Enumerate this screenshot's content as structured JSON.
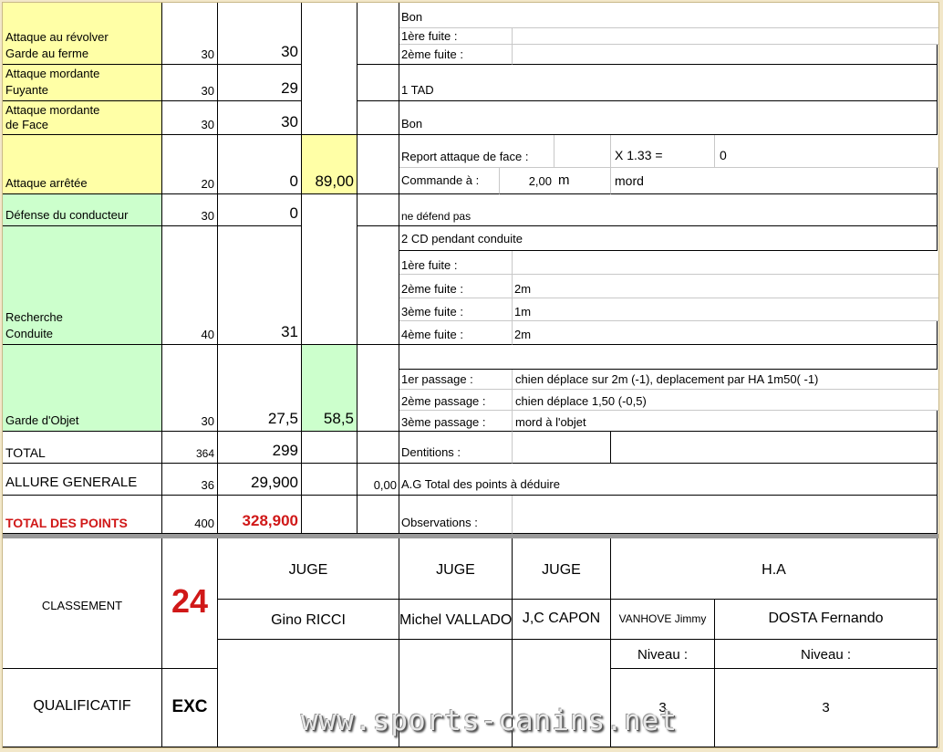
{
  "rows": {
    "revolver": {
      "label_1": "Attaque au révolver",
      "label_2": "Garde au ferme",
      "max": "30",
      "score": "30"
    },
    "fuyante": {
      "label_1": "Attaque mordante",
      "label_2": "Fuyante",
      "max": "30",
      "score": "29",
      "note": "1 TAD"
    },
    "face": {
      "label_1": "Attaque mordante",
      "label_2": "de Face",
      "max": "30",
      "score": "30",
      "note": "Bon"
    },
    "arretee": {
      "label": "Attaque arrêtée",
      "max": "20",
      "score": "0",
      "subtotal": "89,00",
      "report_label": "Report attaque de face :",
      "multiplier": "X 1.33 =",
      "report_value": "0",
      "command_label": "Commande à :",
      "command_value": "2,00",
      "command_unit": "m",
      "command_note": "mord"
    },
    "defense": {
      "label": "Défense du conducteur",
      "max": "30",
      "score": "0",
      "note": "ne défend pas"
    },
    "recherche": {
      "label_1": "Recherche",
      "label_2": "Conduite",
      "max": "40",
      "score": "31",
      "note": "2 CD pendant conduite",
      "fuite_1": "1ère fuite :",
      "fuite_2": "2ème fuite :",
      "fuite_2_val": "2m",
      "fuite_3": "3ème fuite :",
      "fuite_3_val": "1m",
      "fuite_4": "4ème fuite :",
      "fuite_4_val": "2m"
    },
    "garde": {
      "label": "Garde d'Objet",
      "max": "30",
      "score": "27,5",
      "subtotal": "58,5",
      "p1": "1er passage :",
      "p1_val": "chien déplace sur 2m (-1), deplacement par HA 1m50( -1)",
      "p2": "2ème passage :",
      "p2_val": "chien déplace 1,50 (-0,5)",
      "p3": "3ème passage :",
      "p3_val": "mord à l'objet"
    },
    "total": {
      "label": "TOTAL",
      "max": "364",
      "score": "299",
      "dent_label": "Dentitions :"
    },
    "allure": {
      "label": "ALLURE GENERALE",
      "max": "36",
      "score": "29,900",
      "deduct": "0,00",
      "deduct_label": "A.G  Total des points à déduire"
    },
    "points": {
      "label": "TOTAL DES POINTS",
      "max": "400",
      "score": "328,900",
      "obs_label": "Observations :"
    }
  },
  "top_notes": {
    "bon": "Bon",
    "fuite_1": "1ère fuite :",
    "fuite_2": "2ème fuite :"
  },
  "bottom": {
    "classement_label": "CLASSEMENT",
    "classement_value": "24",
    "qualif_label": "QUALIFICATIF",
    "qualif_value": "EXC",
    "judge_1_title": "JUGE",
    "judge_1_name": "Gino RICCI",
    "judge_2_title": "JUGE",
    "judge_2_name": "Michel VALLADON",
    "judge_3_title": "JUGE",
    "judge_3_name": "J,C CAPON",
    "ha_title": "H.A",
    "ha_1_name": "VANHOVE Jimmy",
    "ha_2_name": "DOSTA Fernando",
    "niveau_label_1": "Niveau :",
    "niveau_label_2": "Niveau :",
    "niveau_1": "3",
    "niveau_2": "3"
  },
  "watermark": "www.sports-canins.net",
  "colors": {
    "yellow": "#ffffa6",
    "green": "#ccffcc",
    "red": "#d01818"
  }
}
